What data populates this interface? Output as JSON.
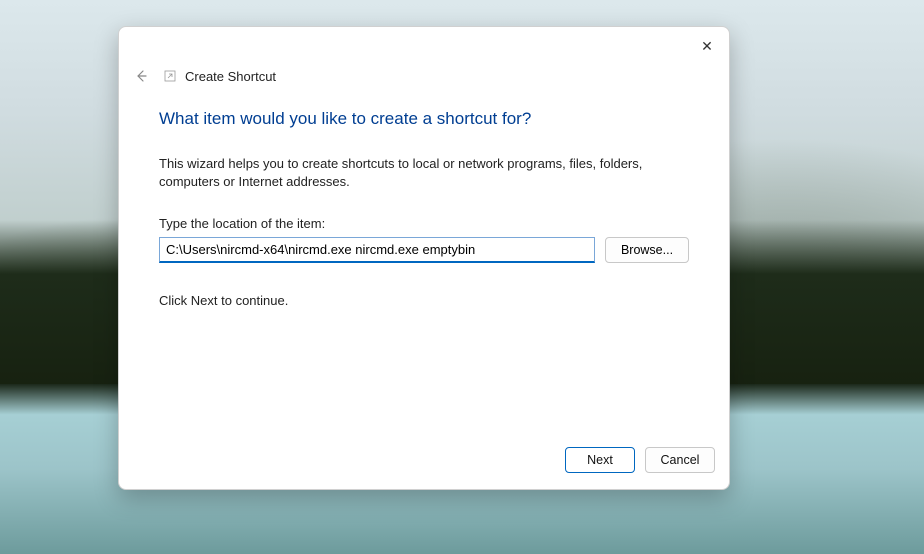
{
  "dialog": {
    "window_title": "Create Shortcut",
    "heading": "What item would you like to create a shortcut for?",
    "description": "This wizard helps you to create shortcuts to local or network programs, files, folders, computers or Internet addresses.",
    "location_label": "Type the location of the item:",
    "location_value": "C:\\Users\\nircmd-x64\\nircmd.exe nircmd.exe emptybin",
    "browse_label": "Browse...",
    "continue_hint": "Click Next to continue.",
    "next_label": "Next",
    "cancel_label": "Cancel"
  },
  "icons": {
    "close": "✕",
    "back": "←",
    "shortcut": "↗"
  }
}
